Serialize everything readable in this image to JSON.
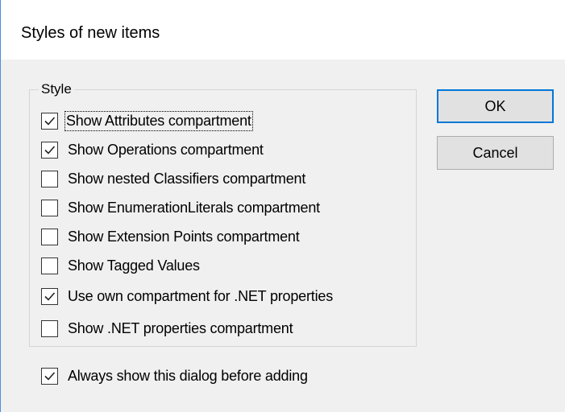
{
  "window": {
    "title": "Styles of new items"
  },
  "group": {
    "label": "Style",
    "options": [
      {
        "label": "Show Attributes compartment",
        "checked": true,
        "focused": true
      },
      {
        "label": "Show Operations compartment",
        "checked": true,
        "focused": false
      },
      {
        "label": "Show nested Classifiers compartment",
        "checked": false,
        "focused": false
      },
      {
        "label": "Show EnumerationLiterals compartment",
        "checked": false,
        "focused": false
      },
      {
        "label": "Show Extension Points compartment",
        "checked": false,
        "focused": false
      },
      {
        "label": "Show Tagged Values",
        "checked": false,
        "focused": false
      },
      {
        "label": "Use own compartment for .NET properties",
        "checked": true,
        "focused": false
      },
      {
        "label": "Show .NET properties compartment",
        "checked": false,
        "focused": false
      }
    ]
  },
  "always_show": {
    "label": "Always show this dialog before adding",
    "checked": true
  },
  "buttons": {
    "ok_label": "OK",
    "cancel_label": "Cancel"
  },
  "colors": {
    "accent": "#0078d7",
    "dialog_bg": "#f0f0f0",
    "button_bg": "#e1e1e1",
    "window_border": "#4a8fd9"
  }
}
